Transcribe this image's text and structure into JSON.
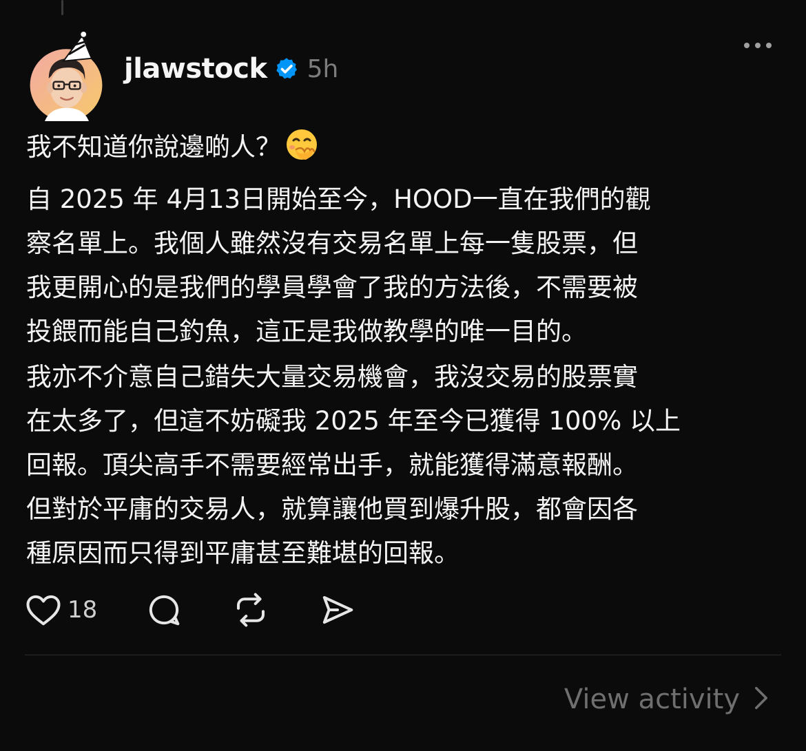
{
  "post": {
    "username": "jlawstock",
    "verified_icon": "verified-badge-icon",
    "time": "5h",
    "more_icon": "more-options-icon",
    "paragraphs": [
      "我不知道你說邊啲人？",
      "自 2025 年 4月13日開始至今，HOOD一直在我們的觀\n察名單上。我個人雖然沒有交易名單上每一隻股票，但\n我更開心的是我們的學員學會了我的方法後，不需要被\n投餵而能自己釣魚，這正是我做教學的唯一目的。",
      "我亦不介意自己錯失大量交易機會，我沒交易的股票實\n在太多了，但這不妨礙我 2025 年至今已獲得 100% 以上\n回報。頂尖高手不需要經常出手，就能獲得滿意報酬。\n但對於平庸的交易人，就算讓他買到爆升股，都會因各\n種原因而只得到平庸甚至難堪的回報。"
    ],
    "emoji": "face-with-hand-over-mouth-emoji"
  },
  "actions": {
    "like_icon": "heart-icon",
    "like_count": "18",
    "reply_icon": "reply-icon",
    "repost_icon": "repost-icon",
    "share_icon": "share-icon"
  },
  "footer": {
    "view_activity_label": "View activity",
    "chevron_icon": "chevron-right-icon"
  },
  "colors": {
    "background": "#0b0b0b",
    "text": "#f3f3f3",
    "muted": "#7d7d7d",
    "verified": "#0095f6"
  }
}
